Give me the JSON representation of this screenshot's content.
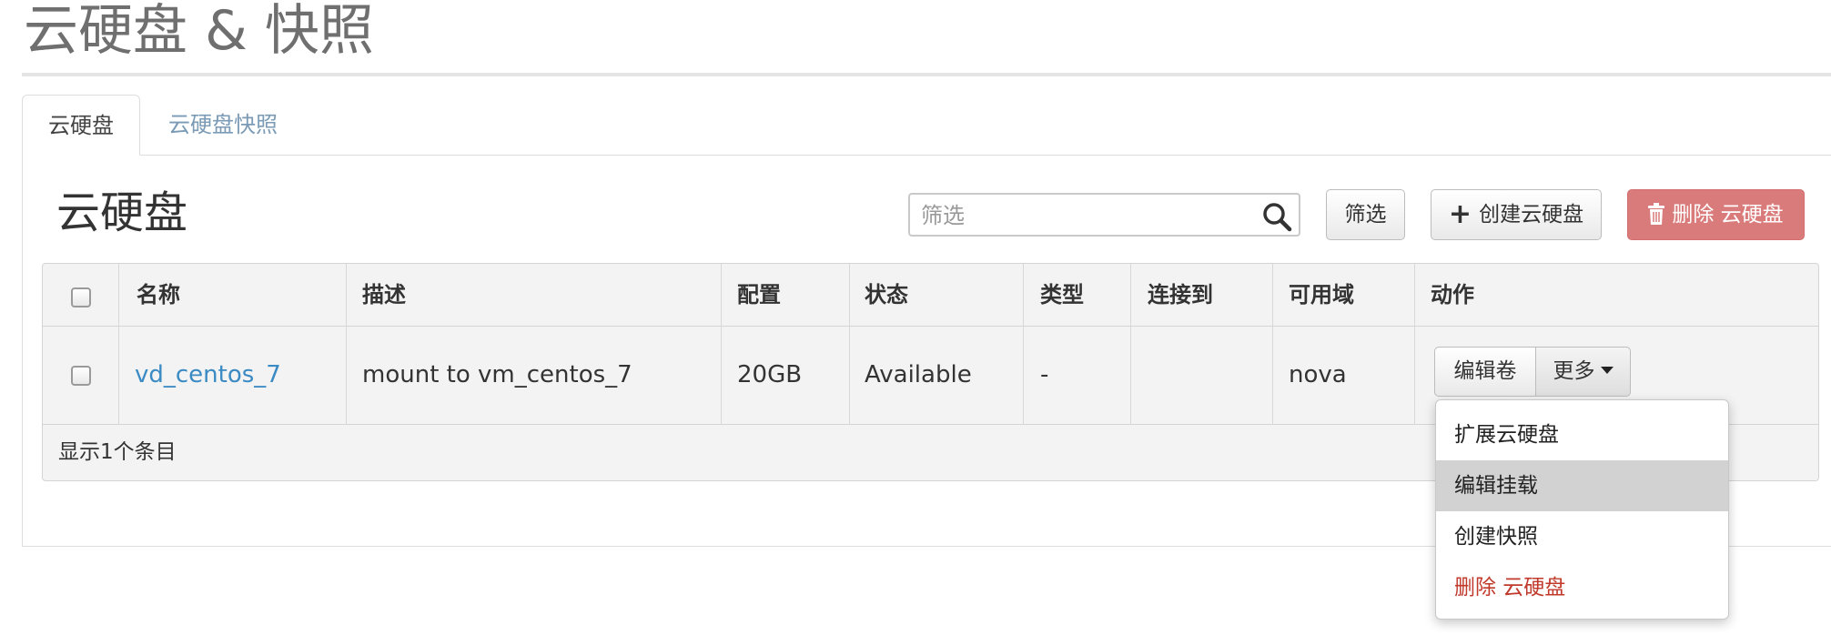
{
  "page": {
    "title": "云硬盘 & 快照"
  },
  "tabs": [
    {
      "label": "云硬盘",
      "active": true
    },
    {
      "label": "云硬盘快照",
      "active": false
    }
  ],
  "section": {
    "title": "云硬盘"
  },
  "search": {
    "placeholder": "筛选",
    "value": "",
    "icon": "search-icon"
  },
  "toolbar": {
    "filter_label": "筛选",
    "create_label": "创建云硬盘",
    "create_icon": "plus-icon",
    "delete_label": "删除 云硬盘",
    "delete_icon": "trash-icon",
    "delete_color": "#d97b7a"
  },
  "table": {
    "columns": [
      "名称",
      "描述",
      "配置",
      "状态",
      "类型",
      "连接到",
      "可用域",
      "动作"
    ],
    "rows": [
      {
        "checked": false,
        "name": "vd_centos_7",
        "description": "mount to vm_centos_7",
        "size": "20GB",
        "status": "Available",
        "type": "-",
        "attached_to": "",
        "zone": "nova",
        "action_primary": "编辑卷",
        "action_more": "更多"
      }
    ],
    "footer": "显示1个条目"
  },
  "dropdown": {
    "items": [
      {
        "label": "扩展云硬盘",
        "state": "normal"
      },
      {
        "label": "编辑挂载",
        "state": "highlighted"
      },
      {
        "label": "创建快照",
        "state": "normal"
      },
      {
        "label": "删除 云硬盘",
        "state": "danger"
      }
    ]
  },
  "colors": {
    "link": "#3a8ac4",
    "danger_text": "#c0392b",
    "danger_button": "#d97b7a",
    "tab_inactive": "#7a9ab5"
  }
}
